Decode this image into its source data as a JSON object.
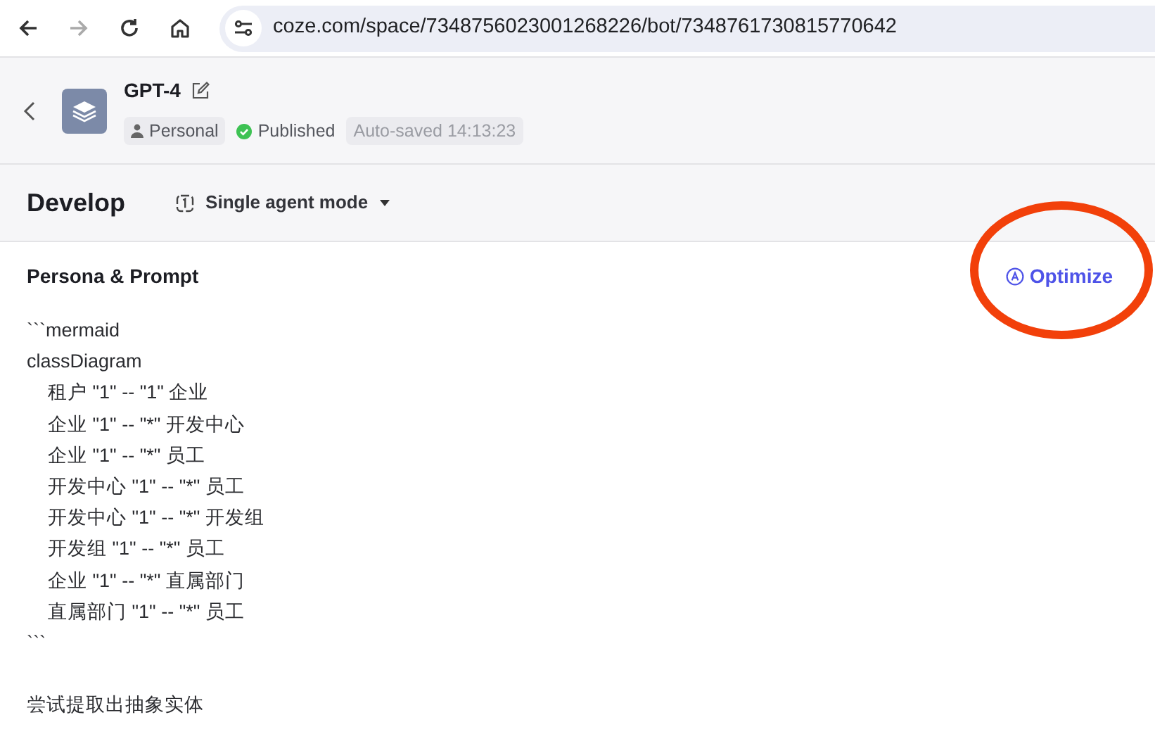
{
  "browser": {
    "url": "coze.com/space/7348756023001268226/bot/7348761730815770642",
    "forward_disabled": true
  },
  "bot": {
    "name": "GPT-4",
    "space": "Personal",
    "status": "Published",
    "autosave": "Auto-saved 14:13:23"
  },
  "develop": {
    "title": "Develop",
    "mode": "Single agent mode"
  },
  "prompt": {
    "title": "Persona & Prompt",
    "action": "Optimize",
    "paragraphs": [
      [
        "```mermaid",
        "classDiagram",
        "    租户 \"1\" -- \"1\" 企业",
        "    企业 \"1\" -- \"*\" 开发中心",
        "    企业 \"1\" -- \"*\" 员工",
        "    开发中心 \"1\" -- \"*\" 员工",
        "    开发中心 \"1\" -- \"*\" 开发组",
        "    开发组 \"1\" -- \"*\" 员工",
        "    企业 \"1\" -- \"*\" 直属部门",
        "    直属部门 \"1\" -- \"*\" 员工",
        "```"
      ],
      [
        "尝试提取出抽象实体"
      ]
    ]
  },
  "annotations": [
    {
      "kind": "ellipse",
      "color": "#f2400a"
    }
  ]
}
